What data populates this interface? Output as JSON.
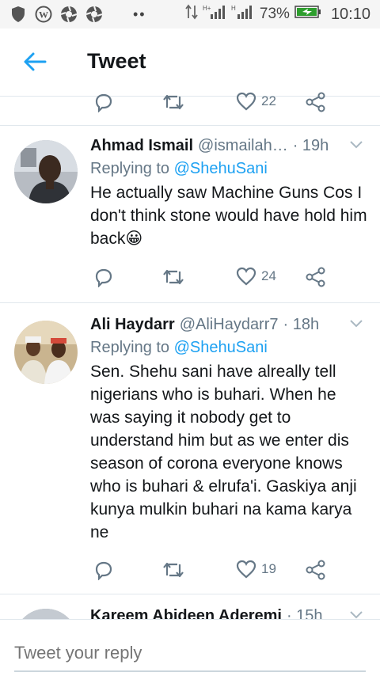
{
  "status": {
    "battery": "73%",
    "time": "10:10",
    "net1": "H+",
    "net2": "H"
  },
  "appbar": {
    "title": "Tweet"
  },
  "top_actions": {
    "likes": "22"
  },
  "tweets": [
    {
      "name": "Ahmad Ismail",
      "handle": "@ismailah…",
      "time": "· 19h",
      "replying_prefix": "Replying to",
      "replying_to": "@ShehuSani",
      "text": "He actually saw Machine Guns Cos I don't think stone would have hold him back",
      "emoji": "😀",
      "likes": "24"
    },
    {
      "name": "Ali Haydarr",
      "handle": "@AliHaydarr7",
      "time": "· 18h",
      "replying_prefix": "Replying to",
      "replying_to": "@ShehuSani",
      "text": "Sen. Shehu sani have alreally tell nigerians who is buhari. When he was saying it nobody get to understand him but as we enter dis season of corona everyone knows who is buhari & elrufa'i. Gaskiya anji kunya mulkin buhari na kama karya ne",
      "likes": "19"
    },
    {
      "name": "Kareem Abideen Aderemi",
      "time": "· 15h"
    }
  ],
  "reply": {
    "placeholder": "Tweet your reply"
  },
  "colors": {
    "accent": "#1da1f2",
    "muted": "#657786",
    "text": "#14171a"
  }
}
